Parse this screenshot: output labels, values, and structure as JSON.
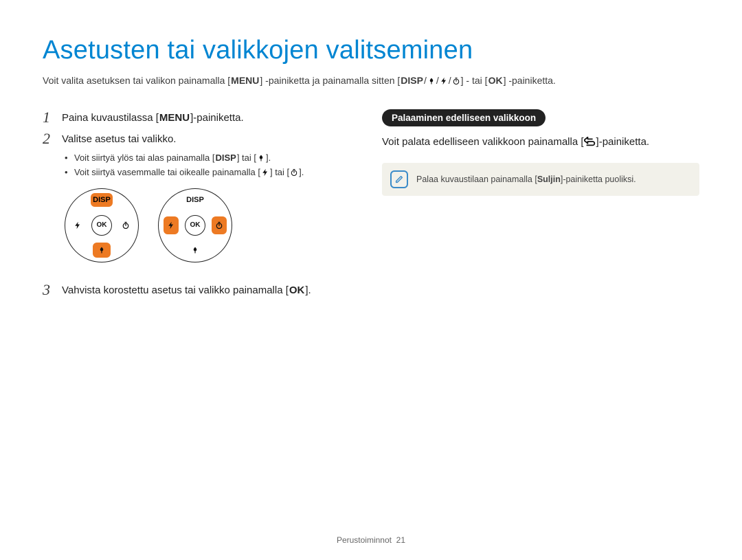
{
  "title": "Asetusten tai valikkojen valitseminen",
  "intro": {
    "pre": "Voit valita asetuksen tai valikon painamalla [",
    "menu": "MENU",
    "mid1": "] -painiketta ja painamalla sitten [",
    "disp": "DISP",
    "slash": "/",
    "mid2": "] - tai [",
    "ok": "OK",
    "post": "] -painiketta."
  },
  "steps": {
    "s1": {
      "num": "1",
      "pre": "Paina kuvaustilassa [",
      "menu": "MENU",
      "post": "]-painiketta."
    },
    "s2": {
      "num": "2",
      "text": "Valitse asetus tai valikko."
    },
    "s2b": {
      "b1_pre": "Voit siirtyä ylös tai alas painamalla [",
      "b1_disp": "DISP",
      "b1_mid": "] tai [",
      "b1_post": "].",
      "b2_pre": "Voit siirtyä vasemmalle tai oikealle painamalla [",
      "b2_mid": "] tai [",
      "b2_post": "]."
    },
    "s3": {
      "num": "3",
      "pre": "Vahvista korostettu asetus tai valikko painamalla [",
      "ok": "OK",
      "post": "]."
    }
  },
  "dial": {
    "disp": "DISP",
    "ok": "OK"
  },
  "right": {
    "badge": "Palaaminen edelliseen valikkoon",
    "p_pre": "Voit palata edelliseen valikkoon painamalla [",
    "p_post": "]-painiketta.",
    "note_pre": "Palaa kuvaustilaan painamalla [",
    "note_bold": "Suljin",
    "note_post": "]-painiketta puoliksi."
  },
  "footer": {
    "section": "Perustoiminnot",
    "page": "21"
  }
}
